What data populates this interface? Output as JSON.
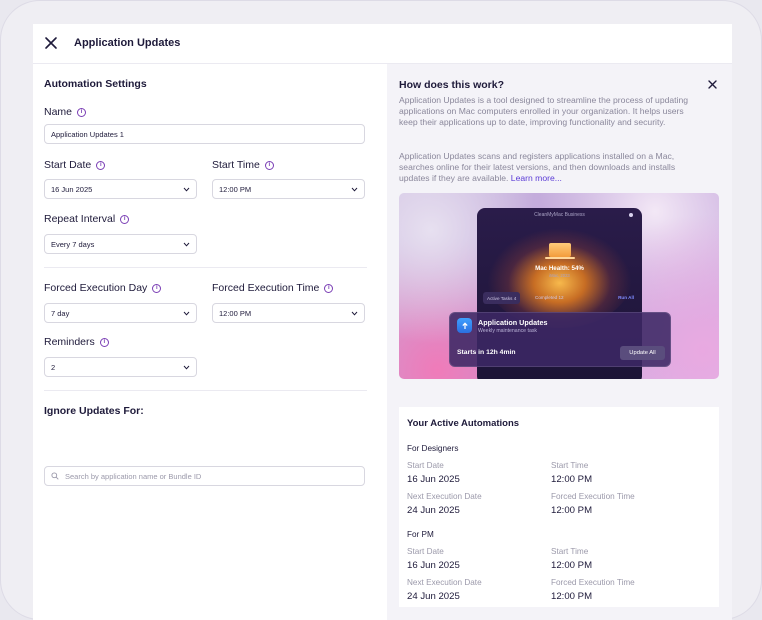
{
  "header": {
    "title": "Application Updates"
  },
  "form": {
    "section_title": "Automation Settings",
    "name_label": "Name",
    "name_value": "Application Updates 1",
    "start_date_label": "Start Date",
    "start_date_value": "16 Jun 2025",
    "start_time_label": "Start Time",
    "start_time_value": "12:00 PM",
    "repeat_label": "Repeat Interval",
    "repeat_value": "Every 7 days",
    "forced_day_label": "Forced Execution Day",
    "forced_day_value": "7 day",
    "forced_time_label": "Forced Execution Time",
    "forced_time_value": "12:00 PM",
    "reminders_label": "Reminders",
    "reminders_value": "2",
    "ignore_title": "Ignore Updates For:",
    "search_placeholder": "Search by application name or Bundle ID"
  },
  "help": {
    "title": "How does this work?",
    "para1": "Application Updates is a tool designed to streamline the process of updating applications on Mac computers enrolled in your organization. It helps users keep their applications up to date, improving functionality and security.",
    "para2": "Application Updates scans and registers applications installed on a Mac, searches online for their latest versions, and then downloads and installs updates if they are available.",
    "learn_more": "Learn more..."
  },
  "preview": {
    "app_title": "CleanMyMac Business",
    "health": "Mac Health:  54%",
    "health_sub": "iMac, 2023",
    "tab_active": "Active Tasks  4",
    "tab_completed": "Completed  12",
    "run_all": "Run All",
    "notif_title": "Application Updates",
    "notif_sub": "Weekly maintenance task",
    "notif_start": "Starts in 12h 4min",
    "notif_button": "Update All"
  },
  "automations": {
    "title": "Your Active Automations",
    "labels": {
      "start_date": "Start Date",
      "start_time": "Start Time",
      "next_exec_date": "Next Execution Date",
      "forced_exec_time": "Forced Execution Time"
    },
    "items": [
      {
        "name": "For Designers",
        "start_date": "16 Jun 2025",
        "start_time": "12:00 PM",
        "next_exec_date": "24 Jun 2025",
        "forced_exec_time": "12:00 PM"
      },
      {
        "name": "For PM",
        "start_date": "16 Jun 2025",
        "start_time": "12:00 PM",
        "next_exec_date": "24 Jun 2025",
        "forced_exec_time": "12:00 PM"
      }
    ]
  },
  "colors": {
    "accent": "#7b3fb5",
    "link": "#5b3bd6"
  }
}
